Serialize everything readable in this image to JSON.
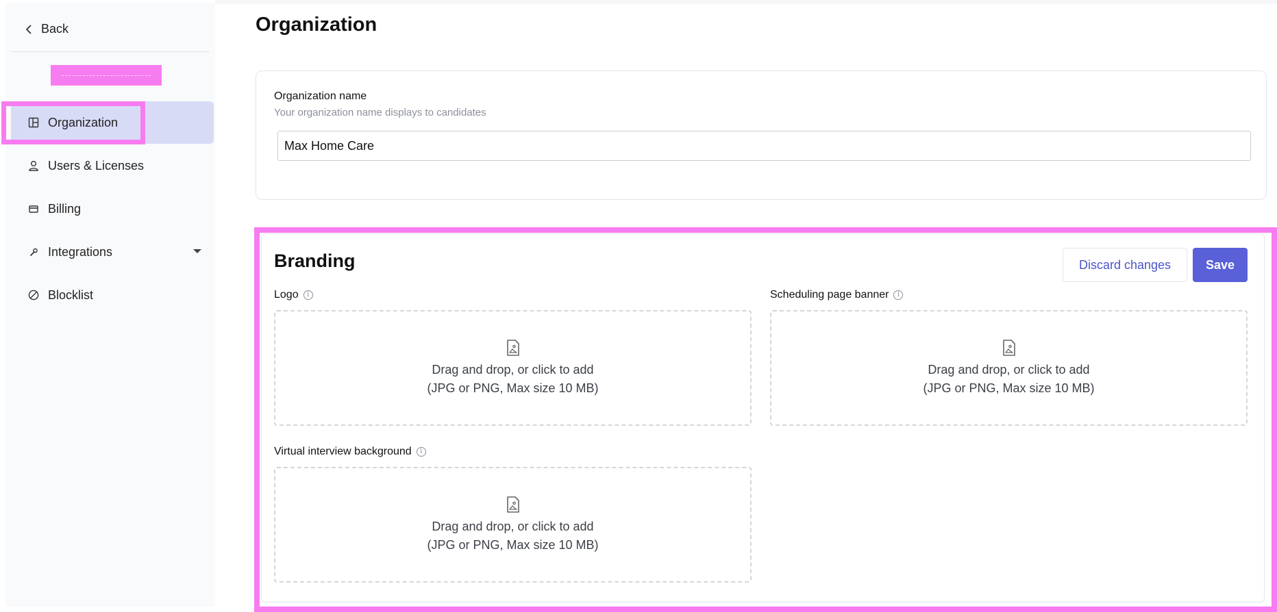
{
  "sidebar": {
    "back_label": "Back",
    "items": [
      {
        "label": "Organization",
        "icon": "layout-icon",
        "active": true
      },
      {
        "label": "Users & Licenses",
        "icon": "user-icon"
      },
      {
        "label": "Billing",
        "icon": "credit-card-icon"
      },
      {
        "label": "Integrations",
        "icon": "wrench-icon",
        "has_dropdown": true
      },
      {
        "label": "Blocklist",
        "icon": "ban-icon"
      }
    ]
  },
  "main": {
    "page_title": "Organization",
    "org_card": {
      "label": "Organization name",
      "help": "Your organization name displays to candidates",
      "value": "Max Home Care"
    },
    "branding": {
      "title": "Branding",
      "discard_label": "Discard changes",
      "save_label": "Save",
      "uploads": [
        {
          "label": "Logo",
          "line1": "Drag and drop, or click to add",
          "line2": "(JPG or PNG, Max size 10 MB)"
        },
        {
          "label": "Scheduling page banner",
          "line1": "Drag and drop, or click to add",
          "line2": "(JPG or PNG, Max size 10 MB)"
        },
        {
          "label": "Virtual interview background",
          "line1": "Drag and drop, or click to add",
          "line2": "(JPG or PNG, Max size 10 MB)"
        }
      ]
    }
  },
  "colors": {
    "accent": "#5960d8",
    "active_nav": "#d8dbf6",
    "highlight": "#f77cf0"
  }
}
